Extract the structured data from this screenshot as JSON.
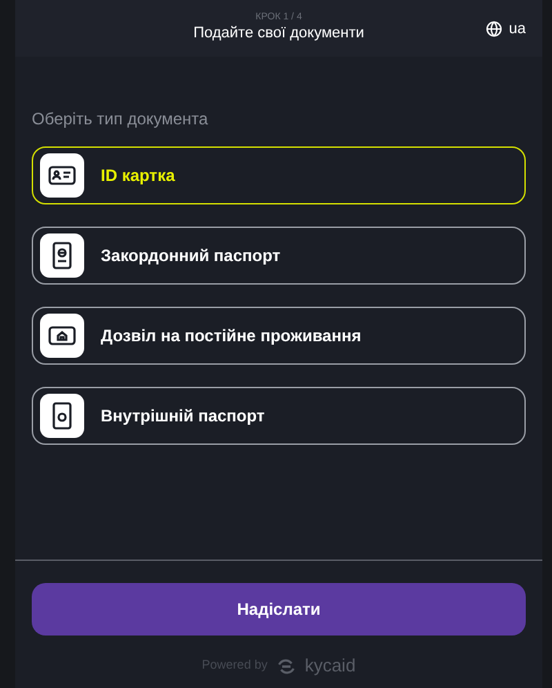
{
  "header": {
    "step": "КРОК 1 / 4",
    "title": "Подайте свої документи",
    "language": "ua"
  },
  "prompt": "Оберіть тип документа",
  "options": [
    {
      "kind": "id-card",
      "label": "ID картка",
      "selected": true
    },
    {
      "kind": "passport",
      "label": "Закордонний паспорт",
      "selected": false
    },
    {
      "kind": "residence",
      "label": "Дозвіл на постійне проживання",
      "selected": false
    },
    {
      "kind": "internal",
      "label": "Внутрішній паспорт",
      "selected": false
    }
  ],
  "submit": "Надіслати",
  "footer": {
    "powered_by": "Powered by",
    "brand": "kycaid"
  }
}
